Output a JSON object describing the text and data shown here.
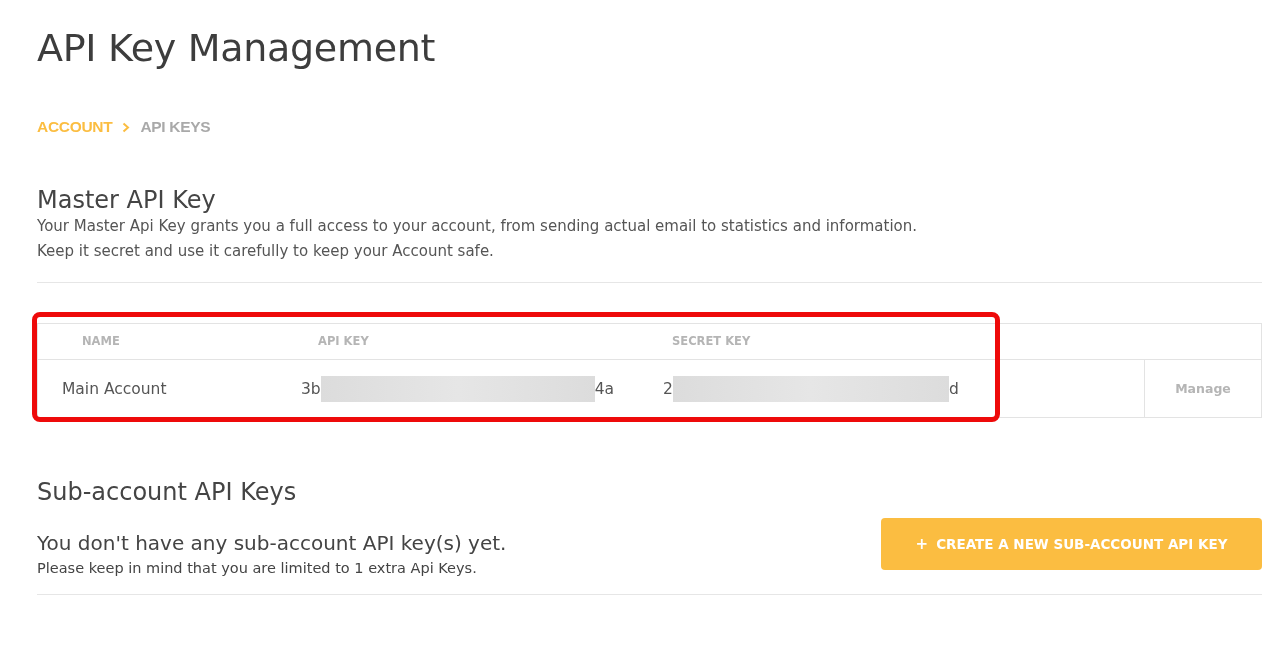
{
  "page": {
    "title": "API Key Management"
  },
  "breadcrumb": [
    {
      "label": "ACCOUNT",
      "selected": false
    },
    {
      "label": "API KEYS",
      "selected": true
    }
  ],
  "master": {
    "heading": "Master API Key",
    "description": [
      "Your Master Api Key grants you a full access to your account, from sending actual email to statistics and information.",
      "Keep it secret and use it carefully to keep your Account safe."
    ],
    "table": {
      "columns": [
        "NAME",
        "API KEY",
        "SECRET KEY"
      ],
      "rows": [
        {
          "name": "Main Account",
          "api_key": {
            "start": "3b",
            "end": "4a"
          },
          "secret_key": {
            "start": "2",
            "end": "d"
          },
          "action": "Manage"
        }
      ]
    },
    "highlighted": true
  },
  "sub_accounts": {
    "heading": "Sub-account API Keys",
    "message": "You don't have any sub-account API key(s) yet.",
    "note": "Please keep in mind that you are limited to 1 extra Api Keys.",
    "button": {
      "icon": "+",
      "label": "CREATE A NEW SUB-ACCOUNT API KEY"
    }
  }
}
